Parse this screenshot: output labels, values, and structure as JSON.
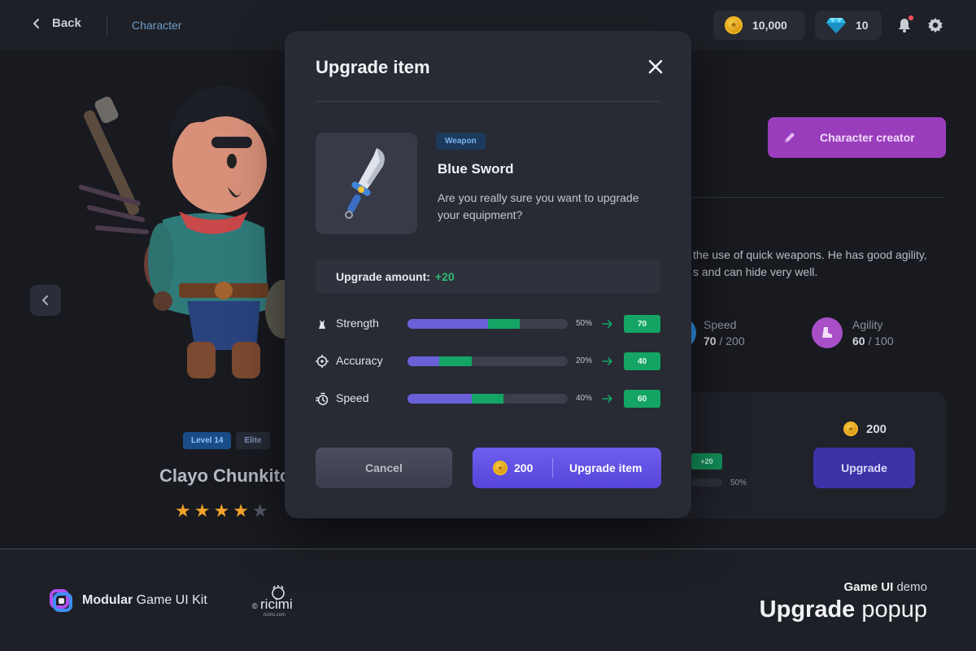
{
  "topbar": {
    "back_label": "Back",
    "breadcrumb": "Character",
    "coins": "10,000",
    "gems": "10"
  },
  "character": {
    "level_badge": "Level 14",
    "rank_badge": "Elite",
    "name": "Clayo Chunkito",
    "rating": 4,
    "rating_max": 5
  },
  "panel": {
    "creator_button": "Character creator",
    "description_line1": "the use of quick weapons. He has good agility,",
    "description_line2": "s and can hide very well.",
    "speed_label": "Speed",
    "speed_value": "70",
    "speed_max": " / 200",
    "agility_label": "Agility",
    "agility_value": "60",
    "agility_max": " / 100",
    "card_price": "200",
    "upgrade_button": "Upgrade",
    "card_badge": "+20",
    "card_percent": "50%"
  },
  "modal": {
    "title": "Upgrade item",
    "item_tag": "Weapon",
    "item_name": "Blue Sword",
    "question": "Are you really sure you want to upgrade your equipment?",
    "amount_label": "Upgrade amount:",
    "amount_value": "+20",
    "stats": [
      {
        "name": "Strength",
        "percent_label": "50%",
        "base_fraction": 0.5,
        "gain_fraction": 0.2,
        "new_value": "70"
      },
      {
        "name": "Accuracy",
        "percent_label": "20%",
        "base_fraction": 0.2,
        "gain_fraction": 0.2,
        "new_value": "40"
      },
      {
        "name": "Speed",
        "percent_label": "40%",
        "base_fraction": 0.4,
        "gain_fraction": 0.2,
        "new_value": "60"
      }
    ],
    "cancel_label": "Cancel",
    "confirm_price": "200",
    "confirm_label": "Upgrade item"
  },
  "footer": {
    "kit_bold": "Modular",
    "kit_rest": " Game UI Kit",
    "brand_logo_text": "©ricimi ricimi.com",
    "demo_bold": "Game UI",
    "demo_rest": " demo",
    "title_bold": "Upgrade",
    "title_rest": " popup"
  },
  "colors": {
    "accent_purple": "#6a60d8",
    "gain_green": "#14a565",
    "creator_magenta": "#9a3dbd",
    "coin_gold": "#f0b825",
    "star_orange": "#f3a32a"
  }
}
